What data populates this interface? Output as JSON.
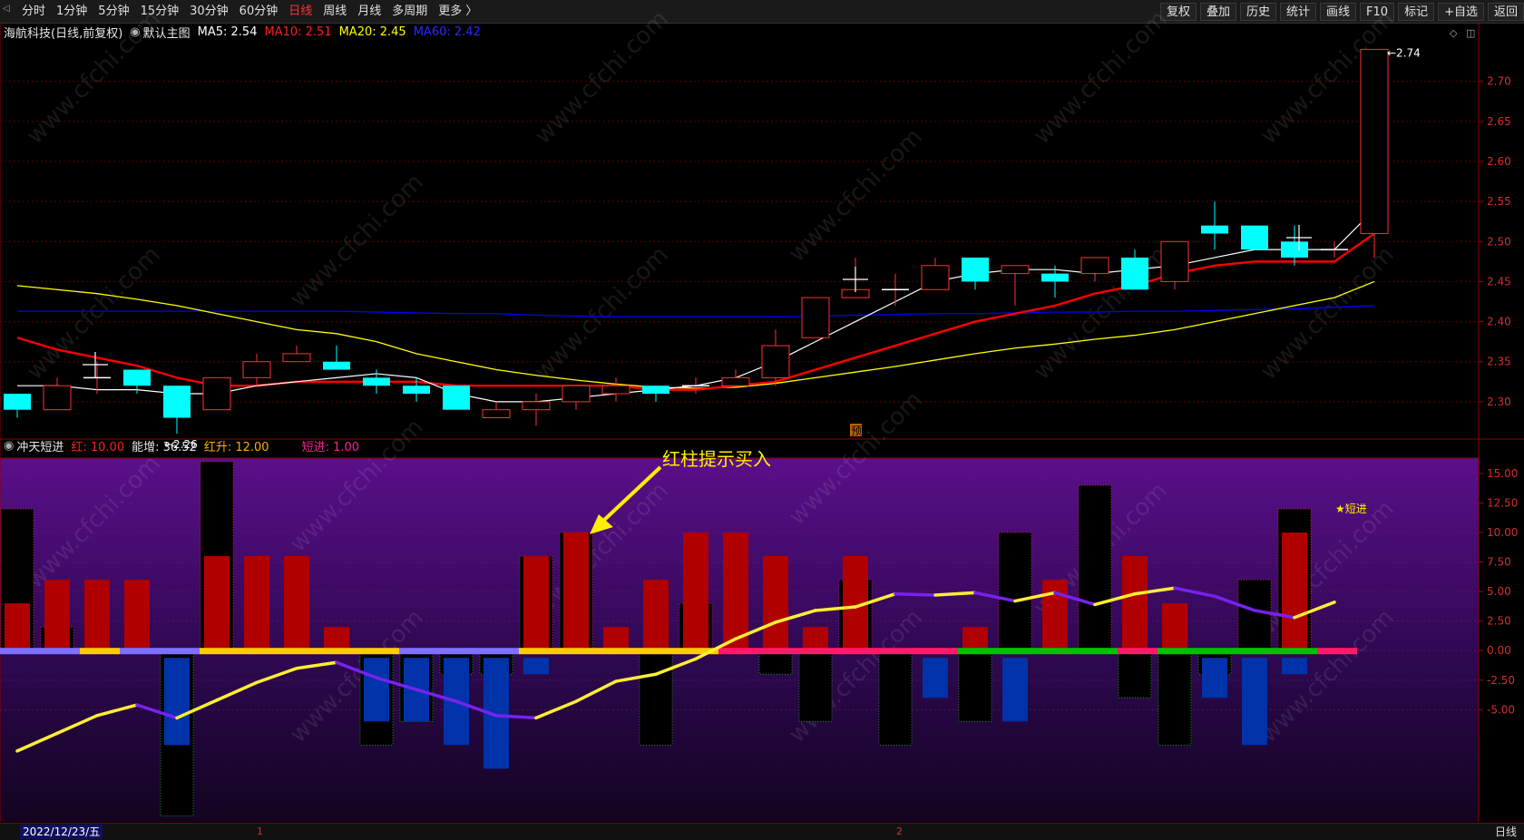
{
  "toolbar": {
    "periods": [
      "分时",
      "1分钟",
      "5分钟",
      "15分钟",
      "30分钟",
      "60分钟",
      "日线",
      "周线",
      "月线",
      "多周期",
      "更多 〉"
    ],
    "active_period": "日线",
    "right_buttons": [
      "复权",
      "叠加",
      "历史",
      "统计",
      "画线",
      "F10",
      "标记",
      "+自选",
      "返回"
    ]
  },
  "main_info": {
    "stock_name": "海航科技(日线,前复权)",
    "chart_label": "默认主图",
    "ma5": "MA5: 2.54",
    "ma10": "MA10: 2.51",
    "ma20": "MA20: 2.45",
    "ma60": "MA60: 2.42"
  },
  "indicator_info": {
    "name": "冲天短进",
    "red": "红: 10.00",
    "energy": "能增: 36.52",
    "red_rise": "红升: 12.00",
    "short_in": "短进: 1.00"
  },
  "colors": {
    "up": "#ff3030",
    "down": "#00ffff",
    "ma5": "#ffffff",
    "ma10": "#ff0000",
    "ma20": "#ffff00",
    "ma60": "#0000ff",
    "bar_red": "#b00000",
    "bar_blue": "#0033aa",
    "line_yellow": "#ffee33",
    "line_purple": "#7722ee"
  },
  "annotations": {
    "high_label": "2.74",
    "low_label": "2.26",
    "pre_mark": "预",
    "buy_hint": "红柱提示买入",
    "short_in_star": "★短进"
  },
  "watermark": "www.cfchi.com",
  "bottom": {
    "date": "2022/12/23/五",
    "mark1": "1",
    "mark2": "2",
    "period": "日线"
  },
  "price_axis": [
    "2.70",
    "2.65",
    "2.60",
    "2.55",
    "2.50",
    "2.45",
    "2.40",
    "2.35",
    "2.30"
  ],
  "ind_axis": [
    "15.00",
    "12.50",
    "10.00",
    "7.50",
    "5.00",
    "2.50",
    "0.00",
    "-2.50",
    "-5.00"
  ],
  "chart_data": {
    "type": "candlestick",
    "candles": [
      {
        "o": 2.31,
        "c": 2.29,
        "h": 2.31,
        "l": 2.28
      },
      {
        "o": 2.29,
        "c": 2.32,
        "h": 2.33,
        "l": 2.29
      },
      {
        "o": 2.33,
        "c": 2.33,
        "h": 2.35,
        "l": 2.31
      },
      {
        "o": 2.34,
        "c": 2.32,
        "h": 2.34,
        "l": 2.31
      },
      {
        "o": 2.32,
        "c": 2.28,
        "h": 2.32,
        "l": 2.26
      },
      {
        "o": 2.29,
        "c": 2.33,
        "h": 2.33,
        "l": 2.29
      },
      {
        "o": 2.33,
        "c": 2.35,
        "h": 2.36,
        "l": 2.32
      },
      {
        "o": 2.35,
        "c": 2.36,
        "h": 2.37,
        "l": 2.35
      },
      {
        "o": 2.35,
        "c": 2.34,
        "h": 2.37,
        "l": 2.34
      },
      {
        "o": 2.33,
        "c": 2.32,
        "h": 2.34,
        "l": 2.31
      },
      {
        "o": 2.32,
        "c": 2.31,
        "h": 2.33,
        "l": 2.3
      },
      {
        "o": 2.32,
        "c": 2.29,
        "h": 2.32,
        "l": 2.29
      },
      {
        "o": 2.28,
        "c": 2.29,
        "h": 2.3,
        "l": 2.28
      },
      {
        "o": 2.29,
        "c": 2.3,
        "h": 2.31,
        "l": 2.27
      },
      {
        "o": 2.3,
        "c": 2.32,
        "h": 2.32,
        "l": 2.29
      },
      {
        "o": 2.31,
        "c": 2.32,
        "h": 2.33,
        "l": 2.3
      },
      {
        "o": 2.32,
        "c": 2.31,
        "h": 2.32,
        "l": 2.3
      },
      {
        "o": 2.32,
        "c": 2.32,
        "h": 2.33,
        "l": 2.31
      },
      {
        "o": 2.32,
        "c": 2.33,
        "h": 2.34,
        "l": 2.32
      },
      {
        "o": 2.33,
        "c": 2.37,
        "h": 2.39,
        "l": 2.32
      },
      {
        "o": 2.38,
        "c": 2.43,
        "h": 2.43,
        "l": 2.38
      },
      {
        "o": 2.43,
        "c": 2.44,
        "h": 2.48,
        "l": 2.43
      },
      {
        "o": 2.44,
        "c": 2.44,
        "h": 2.46,
        "l": 2.42
      },
      {
        "o": 2.44,
        "c": 2.47,
        "h": 2.48,
        "l": 2.44
      },
      {
        "o": 2.48,
        "c": 2.45,
        "h": 2.48,
        "l": 2.44
      },
      {
        "o": 2.46,
        "c": 2.47,
        "h": 2.47,
        "l": 2.42
      },
      {
        "o": 2.46,
        "c": 2.45,
        "h": 2.47,
        "l": 2.43
      },
      {
        "o": 2.46,
        "c": 2.48,
        "h": 2.48,
        "l": 2.45
      },
      {
        "o": 2.48,
        "c": 2.44,
        "h": 2.49,
        "l": 2.44
      },
      {
        "o": 2.45,
        "c": 2.5,
        "h": 2.5,
        "l": 2.44
      },
      {
        "o": 2.52,
        "c": 2.51,
        "h": 2.55,
        "l": 2.49
      },
      {
        "o": 2.52,
        "c": 2.49,
        "h": 2.52,
        "l": 2.49
      },
      {
        "o": 2.5,
        "c": 2.48,
        "h": 2.52,
        "l": 2.47
      },
      {
        "o": 2.49,
        "c": 2.49,
        "h": 2.5,
        "l": 2.48
      },
      {
        "o": 2.51,
        "c": 2.74,
        "h": 2.74,
        "l": 2.48
      }
    ],
    "ma5": [
      2.32,
      2.32,
      2.315,
      2.315,
      2.31,
      2.31,
      2.32,
      2.325,
      2.33,
      2.335,
      2.33,
      2.31,
      2.3,
      2.3,
      2.305,
      2.31,
      2.315,
      2.32,
      2.33,
      2.35,
      2.375,
      2.4,
      2.425,
      2.45,
      2.46,
      2.465,
      2.465,
      2.46,
      2.465,
      2.47,
      2.48,
      2.49,
      2.49,
      2.49,
      2.54
    ],
    "ma10": [
      2.38,
      2.365,
      2.355,
      2.345,
      2.33,
      2.32,
      2.32,
      2.325,
      2.325,
      2.325,
      2.325,
      2.32,
      2.32,
      2.32,
      2.32,
      2.32,
      2.315,
      2.315,
      2.32,
      2.325,
      2.34,
      2.355,
      2.37,
      2.385,
      2.4,
      2.41,
      2.42,
      2.435,
      2.445,
      2.46,
      2.47,
      2.475,
      2.475,
      2.475,
      2.51
    ],
    "ma20": [
      2.445,
      2.44,
      2.435,
      2.428,
      2.42,
      2.41,
      2.4,
      2.39,
      2.385,
      2.375,
      2.36,
      2.35,
      2.34,
      2.333,
      2.327,
      2.322,
      2.318,
      2.317,
      2.318,
      2.323,
      2.33,
      2.337,
      2.344,
      2.352,
      2.36,
      2.367,
      2.372,
      2.378,
      2.383,
      2.39,
      2.4,
      2.41,
      2.42,
      2.43,
      2.45
    ],
    "ma60": [
      2.413,
      2.413,
      2.413,
      2.413,
      2.413,
      2.413,
      2.413,
      2.413,
      2.413,
      2.412,
      2.411,
      2.41,
      2.41,
      2.408,
      2.407,
      2.406,
      2.406,
      2.406,
      2.406,
      2.406,
      2.407,
      2.408,
      2.409,
      2.41,
      2.41,
      2.411,
      2.412,
      2.412,
      2.413,
      2.413,
      2.414,
      2.415,
      2.416,
      2.418,
      2.42
    ],
    "indicator": {
      "red_bars": [
        4,
        6,
        6,
        6,
        0,
        8,
        8,
        8,
        2,
        0,
        0,
        0,
        0,
        8,
        10,
        2,
        6,
        10,
        10,
        8,
        2,
        8,
        0,
        0,
        2,
        0,
        6,
        0,
        8,
        4,
        0,
        0,
        10
      ],
      "blue_bars": [
        0,
        0,
        0,
        0,
        -8,
        0,
        0,
        0,
        0,
        -6,
        -6,
        -8,
        -10,
        -2,
        0,
        0,
        0,
        0,
        0,
        0,
        0,
        0,
        0,
        -4,
        0,
        -6,
        0,
        0,
        0,
        0,
        -4,
        -8,
        -2
      ],
      "black_bars": [
        12,
        2,
        0,
        0,
        -14,
        16,
        0,
        0,
        0,
        -8,
        -6,
        -2,
        -2,
        8,
        10,
        0,
        -8,
        4,
        0,
        -2,
        -6,
        6,
        -8,
        0,
        -6,
        10,
        0,
        14,
        -4,
        -8,
        -2,
        6,
        12
      ],
      "line": [
        -8.5,
        -7,
        -5.5,
        -4.6,
        -5.7,
        -4.2,
        -2.7,
        -1.5,
        -1.0,
        -2.3,
        -3.3,
        -4.3,
        -5.5,
        -5.7,
        -4.3,
        -2.6,
        -2.0,
        -0.7,
        1.0,
        2.4,
        3.4,
        3.7,
        4.8,
        4.7,
        4.9,
        4.2,
        4.9,
        3.9,
        4.8,
        5.3,
        4.6,
        3.4,
        2.8,
        4.1
      ],
      "bar_colors_row": [
        "purple",
        "purple",
        "yellow",
        "purple",
        "purple",
        "yellow",
        "yellow",
        "yellow",
        "yellow",
        "yellow",
        "purple",
        "purple",
        "purple",
        "yellow",
        "yellow",
        "yellow",
        "yellow",
        "yellow",
        "pink",
        "pink",
        "pink",
        "pink",
        "pink",
        "pink",
        "green",
        "green",
        "green",
        "green",
        "pink",
        "green",
        "green",
        "green",
        "green",
        "pink"
      ]
    }
  }
}
